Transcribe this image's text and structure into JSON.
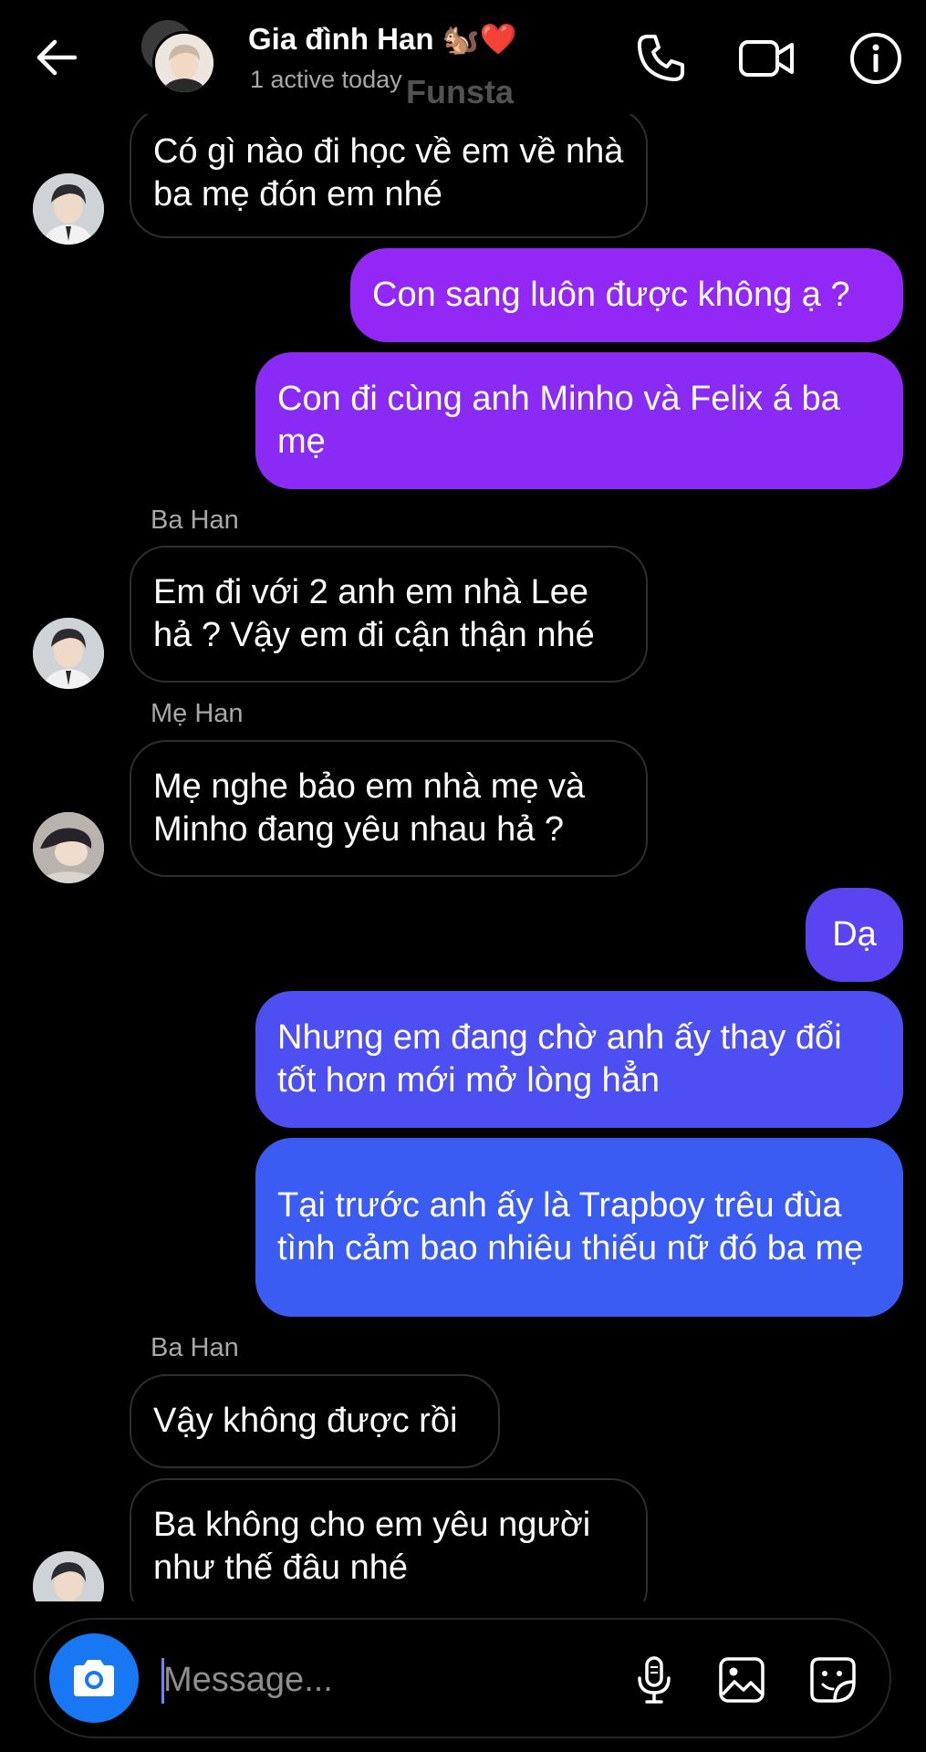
{
  "header": {
    "back_icon": "arrow-left-icon",
    "title": "Gia đình Han 🐿️❤️",
    "status": "1 active today",
    "watermark": "Funsta",
    "call_icon": "phone-icon",
    "video_icon": "video-camera-icon",
    "info_icon": "info-icon"
  },
  "messages": [
    {
      "direction": "incoming",
      "text": "Có gì nào đi học về em về nhà ba mẹ đón em nhé"
    },
    {
      "direction": "outgoing",
      "text": "Con sang luôn được không ạ ?"
    },
    {
      "direction": "outgoing",
      "text": "Con đi cùng anh Minho và Felix á ba mẹ"
    },
    {
      "direction": "incoming",
      "sender": "Ba Han",
      "text": "Em đi với 2 anh em nhà Lee hả ? Vậy em đi cận thận nhé"
    },
    {
      "direction": "incoming",
      "sender": "Mẹ Han",
      "text": "Mẹ nghe bảo em nhà mẹ và Minho đang yêu nhau hả ?"
    },
    {
      "direction": "outgoing",
      "text": "Dạ"
    },
    {
      "direction": "outgoing",
      "text": "Nhưng em đang chờ anh ấy thay đổi tốt hơn mới mở lòng hẳn"
    },
    {
      "direction": "outgoing",
      "text": "Tại trước anh ấy là Trapboy trêu đùa tình cảm bao nhiêu thiếu nữ đó ba mẹ"
    },
    {
      "direction": "incoming",
      "sender": "Ba Han",
      "text": "Vậy không được rồi"
    },
    {
      "direction": "incoming",
      "text": "Ba không cho em yêu người như thế đâu nhé"
    }
  ],
  "composer": {
    "placeholder": "Message...",
    "camera_icon": "camera-icon",
    "mic_icon": "microphone-icon",
    "gallery_icon": "image-icon",
    "sticker_icon": "sticker-icon"
  },
  "colors": {
    "background": "#000000",
    "incoming_border": "#2f2f2f",
    "gradient_top": "#9d24f6",
    "gradient_bottom": "#2f64f2",
    "camera_button": "#1877f2",
    "secondary_text": "#a8a8a8"
  }
}
